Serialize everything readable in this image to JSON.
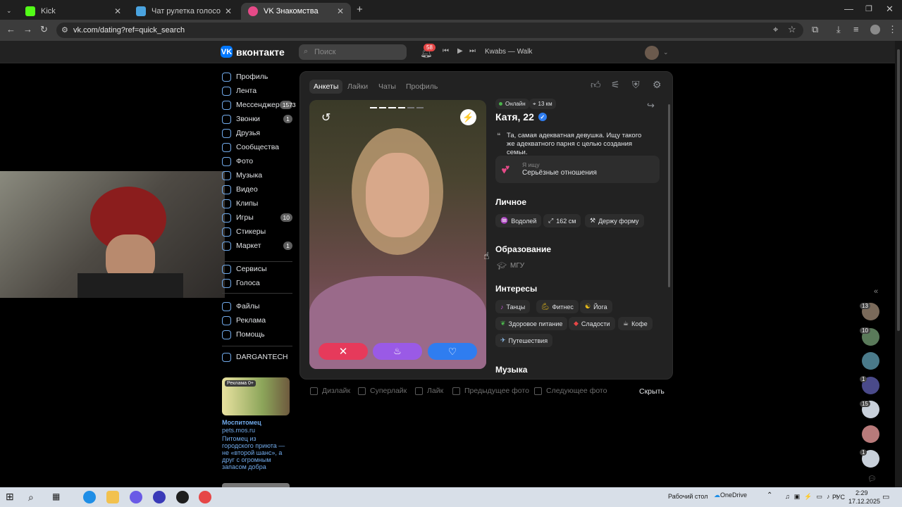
{
  "browser": {
    "tabs": [
      {
        "title": "Kick"
      },
      {
        "title": "Чат рулетка голосовая — Nek"
      },
      {
        "title": "VK Знакомства"
      }
    ],
    "url": "vk.com/dating?ref=quick_search"
  },
  "header": {
    "logo": "вконтакте",
    "search_placeholder": "Поиск",
    "notif_count": "58",
    "track": "Kwabs — Walk"
  },
  "sidebar": {
    "items": [
      {
        "label": "Профиль",
        "count": ""
      },
      {
        "label": "Лента",
        "count": ""
      },
      {
        "label": "Мессенджер",
        "count": "1573"
      },
      {
        "label": "Звонки",
        "count": "1"
      },
      {
        "label": "Друзья",
        "count": ""
      },
      {
        "label": "Сообщества",
        "count": ""
      },
      {
        "label": "Фото",
        "count": ""
      },
      {
        "label": "Музыка",
        "count": ""
      },
      {
        "label": "Видео",
        "count": ""
      },
      {
        "label": "Клипы",
        "count": ""
      },
      {
        "label": "Игры",
        "count": "10"
      },
      {
        "label": "Стикеры",
        "count": ""
      },
      {
        "label": "Маркет",
        "count": "1"
      },
      {
        "label": "Сервисы",
        "count": ""
      },
      {
        "label": "Голоса",
        "count": ""
      },
      {
        "label": "Файлы",
        "count": ""
      },
      {
        "label": "Реклама",
        "count": ""
      },
      {
        "label": "Помощь",
        "count": ""
      },
      {
        "label": "DARGANTECH",
        "count": ""
      }
    ],
    "ad": {
      "badge": "Реклама 0+",
      "title": "Моспитомец",
      "domain": "pets.mos.ru",
      "text": "Питомец из городского приюта — не «второй шанс», а друг с огромным запасом добра"
    }
  },
  "dating": {
    "tabs": [
      "Анкеты",
      "Лайки",
      "Чаты",
      "Профиль"
    ],
    "status_online": "Онлайн",
    "distance": "13 км",
    "name": "Катя, 22",
    "bio": "Та, самая адекватная девушка. Ищу такого же адекватного парня с целью создания семьи.",
    "looking_label": "Я ищу",
    "looking_value": "Серьёзные отношения",
    "personal_title": "Личное",
    "personal": [
      "Водолей",
      "162 см",
      "Держу форму"
    ],
    "education_title": "Образование",
    "education": "МГУ",
    "interests_title": "Интересы",
    "interests": [
      "Танцы",
      "Фитнес",
      "Йога",
      "Здоровое питание",
      "Сладости",
      "Кофе",
      "Путешествия"
    ],
    "music_title": "Музыка",
    "bottom": [
      "Дизлайк",
      "Суперлайк",
      "Лайк",
      "Предыдущее фото",
      "Следующее фото"
    ],
    "hide": "Скрыть"
  },
  "right_badges": [
    "13",
    "10",
    "1",
    "15",
    "1"
  ],
  "taskbar": {
    "desktop": "Рабочий стол",
    "onedrive": "OneDrive",
    "lang": "РУС",
    "time": "2:29",
    "date": "17.12.2025"
  }
}
